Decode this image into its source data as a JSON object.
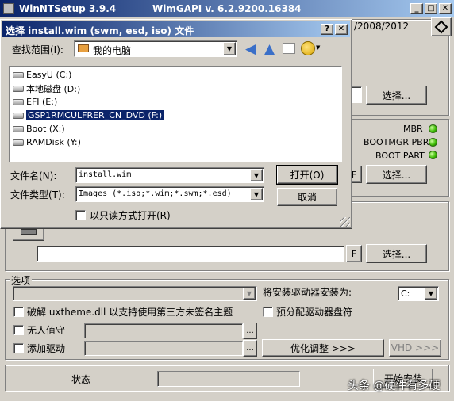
{
  "app": {
    "title": "WinNTSetup 3.9.4",
    "wimgapi": "WimGAPI v. 6.2.9200.16384",
    "os_label": "/2008/2012"
  },
  "main": {
    "browse_label": "选择...",
    "status": [
      {
        "label": "MBR"
      },
      {
        "label": "BOOTMGR PBR"
      },
      {
        "label": "BOOT PART"
      }
    ],
    "f_label": "F"
  },
  "options": {
    "legend": "选项",
    "install_drive_label": "将安装驱动器安装为:",
    "install_drive_value": "C:",
    "uxtheme_label": "破解 uxtheme.dll 以支持使用第三方未签名主题",
    "prealloc_label": "预分配驱动器盘符",
    "unattended_label": "无人值守",
    "add_driver_label": "添加驱动",
    "ellipsis": "...",
    "tweaks_label": "优化调整 >>>",
    "vhd_label": "VHD >>>"
  },
  "footer": {
    "status_label": "状态",
    "start_label": "开始安装"
  },
  "watermark": "头条 @硬件有多硬",
  "dialog": {
    "title": "选择 install.wim (swm, esd, iso) 文件",
    "lookin_label": "查找范围(I):",
    "lookin_value": "我的电脑",
    "drives": [
      {
        "label": "EasyU (C:)",
        "selected": false
      },
      {
        "label": "本地磁盘 (D:)",
        "selected": false
      },
      {
        "label": "EFI (E:)",
        "selected": false
      },
      {
        "label": "GSP1RMCULFRER_CN_DVD (F:)",
        "selected": true
      },
      {
        "label": "Boot (X:)",
        "selected": false
      },
      {
        "label": "RAMDisk (Y:)",
        "selected": false
      }
    ],
    "filename_label": "文件名(N):",
    "filename_value": "install.wim",
    "filetype_label": "文件类型(T):",
    "filetype_value": "Images (*.iso;*.wim;*.swm;*.esd)",
    "open_label": "打开(O)",
    "cancel_label": "取消",
    "readonly_label": "以只读方式打开(R)"
  }
}
